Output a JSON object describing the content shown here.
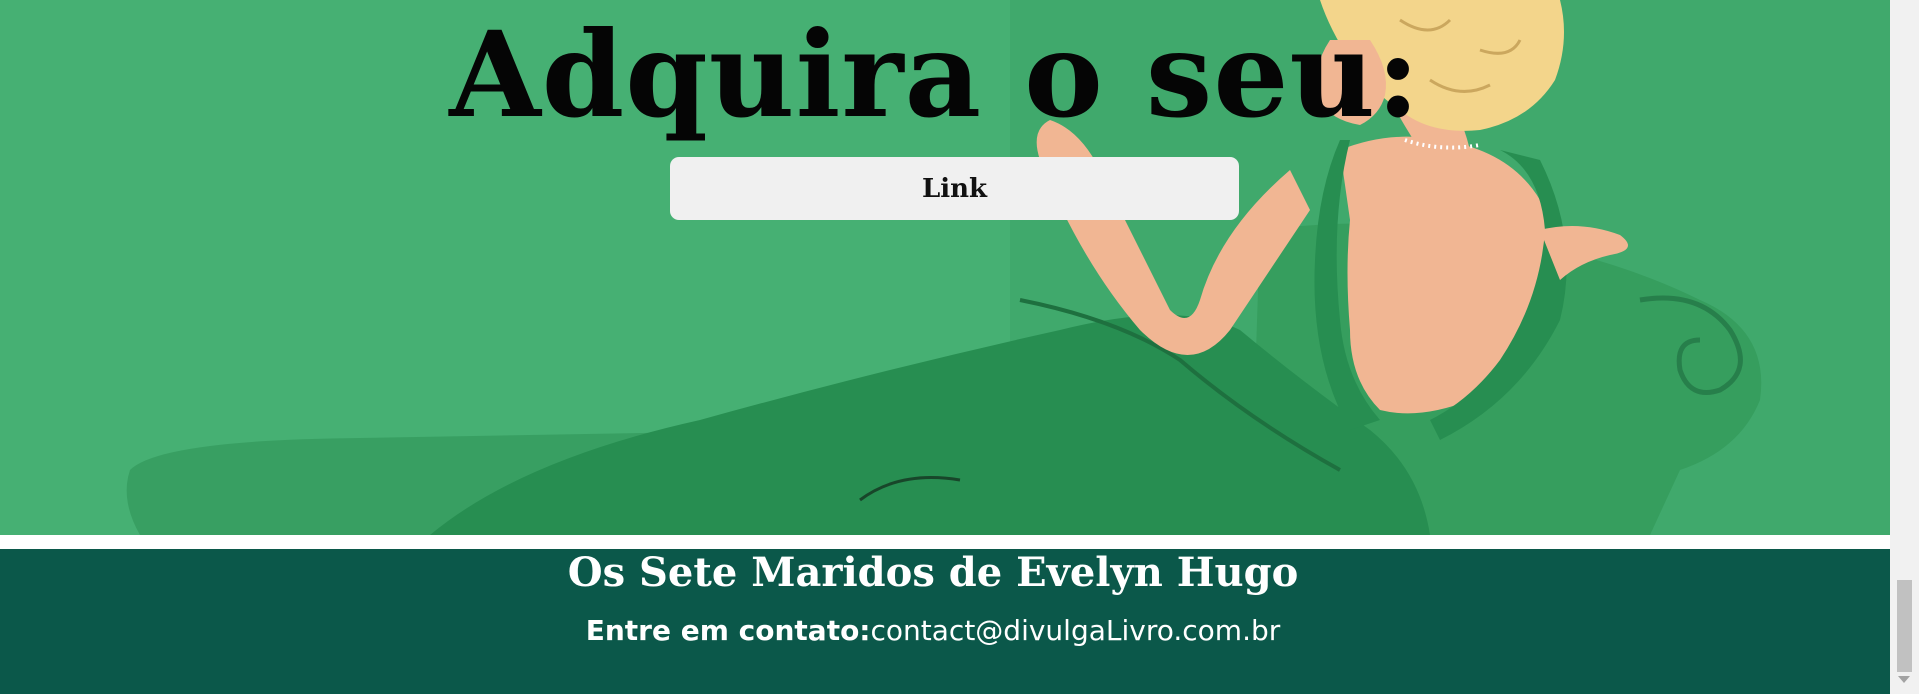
{
  "hero": {
    "title": "Adquira o seu:",
    "link_button_label": "Link",
    "background_color": "#3fad6e"
  },
  "footer": {
    "title": "Os Sete Maridos de Evelyn Hugo",
    "contact_label": "Entre em contato:",
    "contact_email": "contact@divulgaLivro.com.br",
    "background_color": "#0b584a"
  },
  "scrollbar": {
    "scroll_position": 0.95
  }
}
